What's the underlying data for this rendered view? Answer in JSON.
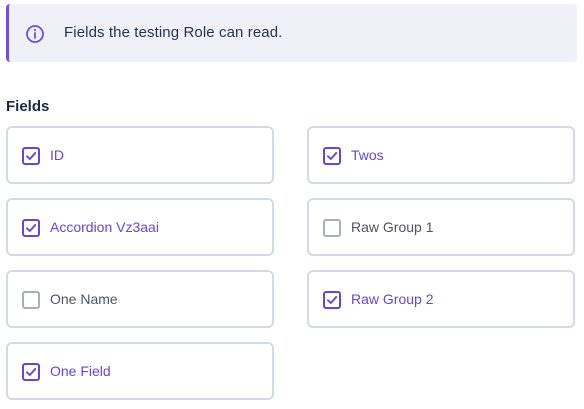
{
  "notice": {
    "icon": "info-circle-icon",
    "text": "Fields the testing Role can read.",
    "accent_color": "#6d4ee6"
  },
  "section": {
    "label": "Fields"
  },
  "fields": [
    {
      "label": "ID",
      "checked": true
    },
    {
      "label": "Twos",
      "checked": true
    },
    {
      "label": "Accordion Vz3aai",
      "checked": true
    },
    {
      "label": "Raw Group 1",
      "checked": false
    },
    {
      "label": "One Name",
      "checked": false
    },
    {
      "label": "Raw Group 2",
      "checked": true
    },
    {
      "label": "One Field",
      "checked": true
    }
  ],
  "colors": {
    "checked": "#6644e2",
    "unchecked_border": "#a2b0c2",
    "card_border": "#d4dae3"
  }
}
